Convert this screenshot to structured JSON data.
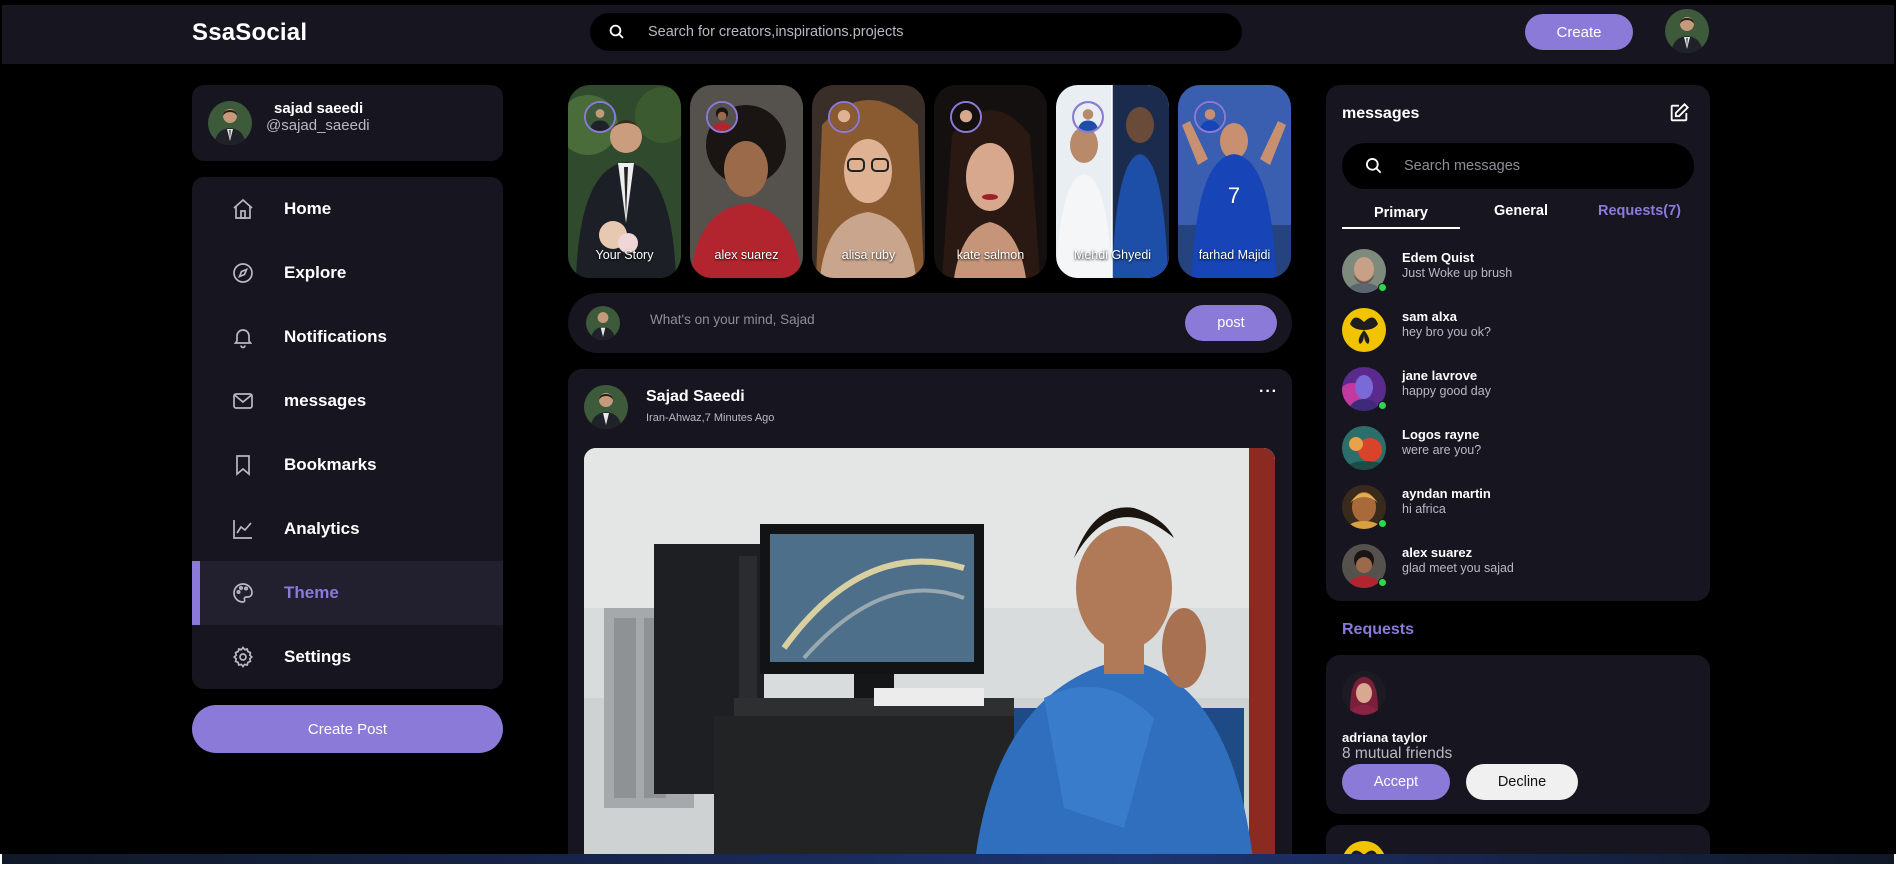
{
  "app": {
    "logo": "SsaSocial"
  },
  "topnav": {
    "search_placeholder": "Search for creators,inspirations.projects",
    "create_label": "Create"
  },
  "profile": {
    "name": "sajad saeedi",
    "handle": "@sajad_saeedi"
  },
  "sidebar": {
    "items": [
      {
        "label": "Home",
        "icon": "home-icon",
        "active": false
      },
      {
        "label": "Explore",
        "icon": "compass-icon",
        "active": false
      },
      {
        "label": "Notifications",
        "icon": "bell-icon",
        "active": false
      },
      {
        "label": "messages",
        "icon": "mail-icon",
        "active": false
      },
      {
        "label": "Bookmarks",
        "icon": "bookmark-icon",
        "active": false
      },
      {
        "label": "Analytics",
        "icon": "chart-icon",
        "active": false
      },
      {
        "label": "Theme",
        "icon": "palette-icon",
        "active": true
      },
      {
        "label": "Settings",
        "icon": "gear-icon",
        "active": false
      }
    ],
    "create_post_label": "Create Post"
  },
  "stories": [
    {
      "name": "Your Story"
    },
    {
      "name": "alex suarez"
    },
    {
      "name": "alisa ruby"
    },
    {
      "name": "kate salmon"
    },
    {
      "name": "Mehdi Ghyedi"
    },
    {
      "name": "farhad Majidi"
    }
  ],
  "composer": {
    "placeholder": "What's on your mind, Sajad",
    "post_label": "post"
  },
  "feed": {
    "author": "Sajad Saeedi",
    "meta": "Iran-Ahwaz,7 Minutes Ago",
    "more_label": "···"
  },
  "messages": {
    "title": "messages",
    "search_placeholder": "Search messages",
    "tabs": {
      "primary": "Primary",
      "general": "General",
      "requests": "Requests(7)"
    },
    "items": [
      {
        "name": "Edem Quist",
        "text": "Just Woke up brush",
        "online": true
      },
      {
        "name": "sam alxa",
        "text": "hey bro you ok?",
        "online": false
      },
      {
        "name": "jane lavrove",
        "text": "happy good day",
        "online": true
      },
      {
        "name": "Logos rayne",
        "text": "were are you?",
        "online": false
      },
      {
        "name": "ayndan martin",
        "text": "hi africa",
        "online": true
      },
      {
        "name": "alex suarez",
        "text": "glad meet you sajad",
        "online": true
      }
    ]
  },
  "requests": {
    "heading": "Requests",
    "items": [
      {
        "name": "adriana taylor",
        "mutual": "8 mutual friends",
        "accept_label": "Accept",
        "decline_label": "Decline"
      }
    ]
  },
  "colors": {
    "accent": "#8b7ad8",
    "panel": "#17151f",
    "online": "#2fd84b"
  }
}
